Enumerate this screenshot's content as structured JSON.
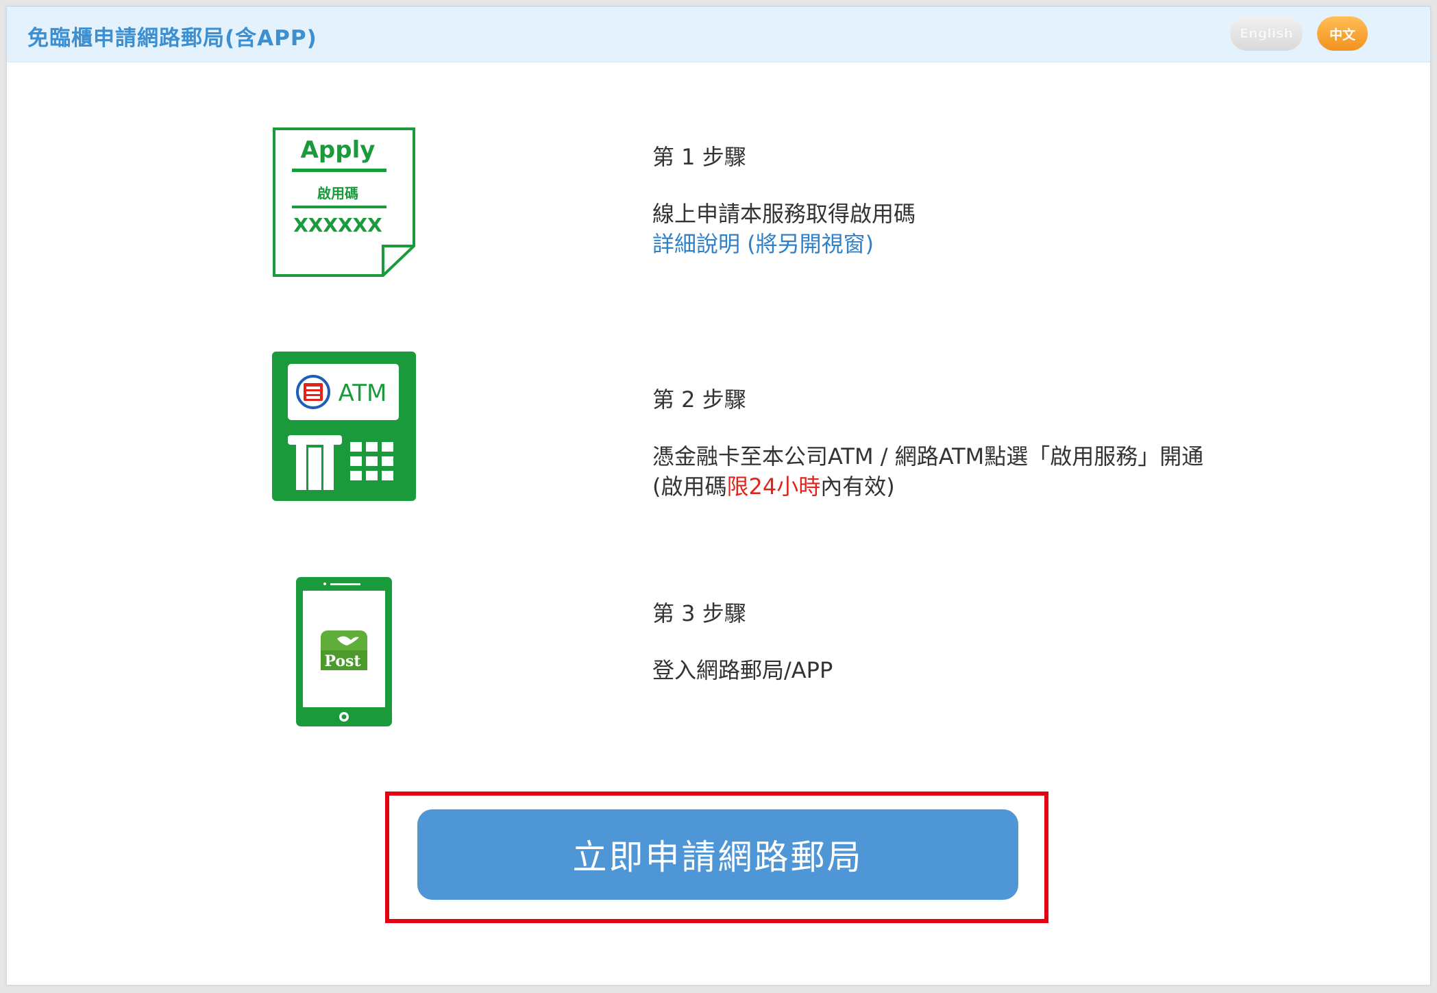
{
  "header": {
    "title": "免臨櫃申請網路郵局(含APP)",
    "lang_english": "English",
    "lang_chinese": "中文"
  },
  "steps": [
    {
      "title": "第 1 步驟",
      "desc": "線上申請本服務取得啟用碼",
      "link": "詳細說明 (將另開視窗)",
      "icon": "apply-document-icon",
      "icon_texts": {
        "apply": "Apply",
        "code_label": "啟用碼",
        "code": "XXXXXX"
      }
    },
    {
      "title": "第 2 步驟",
      "desc": "憑金融卡至本公司ATM / 網路ATM點選「啟用服務」開通",
      "note_prefix": "(啟用碼",
      "note_highlight": "限24小時",
      "note_suffix": "內有效)",
      "icon": "atm-machine-icon",
      "icon_texts": {
        "atm": "ATM"
      }
    },
    {
      "title": "第 3 步驟",
      "desc": "登入網路郵局/APP",
      "icon": "mobile-post-app-icon",
      "icon_texts": {
        "post": "Post"
      }
    }
  ],
  "cta": {
    "label": "立即申請網路郵局"
  },
  "colors": {
    "brand_green": "#1a9a3a",
    "header_blue": "#3d8fd0",
    "button_blue": "#4f96d6",
    "highlight_red": "#e60012",
    "lang_orange": "#f3921e"
  }
}
